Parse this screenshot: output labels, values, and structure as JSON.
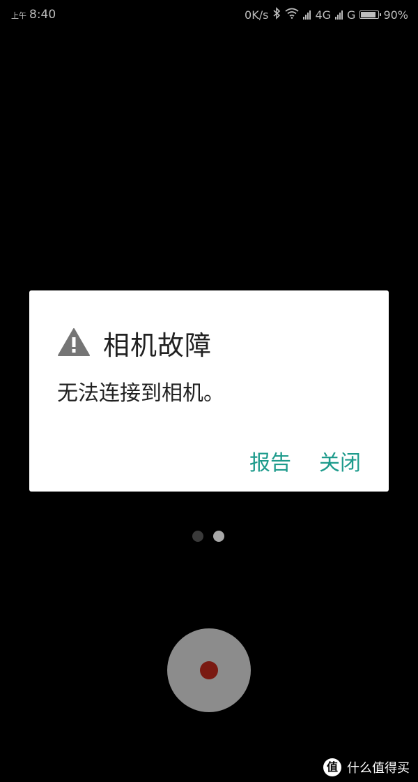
{
  "status_bar": {
    "ampm": "上午",
    "time": "8:40",
    "net_speed": "0K/s",
    "network_1": "4G",
    "network_2": "G",
    "battery_text": "90%",
    "battery_level": 0.9,
    "icons": [
      "bluetooth-icon",
      "wifi-icon",
      "signal-icon",
      "signal-icon",
      "battery-icon"
    ]
  },
  "dialog": {
    "icon": "warning-icon",
    "title": "相机故障",
    "message": "无法连接到相机。",
    "buttons": {
      "report": "报告",
      "close": "关闭"
    }
  },
  "page_indicator": {
    "count": 2,
    "active_index": 1
  },
  "shutter": {
    "icon": "record-dot-icon"
  },
  "watermark": {
    "logo_text": "值",
    "text": "什么值得买"
  },
  "colors": {
    "accent": "#1e9b8c",
    "dialog_bg": "#ffffff",
    "background": "#000000",
    "dot_inactive": "#3a3a3a",
    "dot_active": "#a8a8a8",
    "shutter_bg": "#8c8c8c",
    "record_red": "#7a1a12"
  }
}
